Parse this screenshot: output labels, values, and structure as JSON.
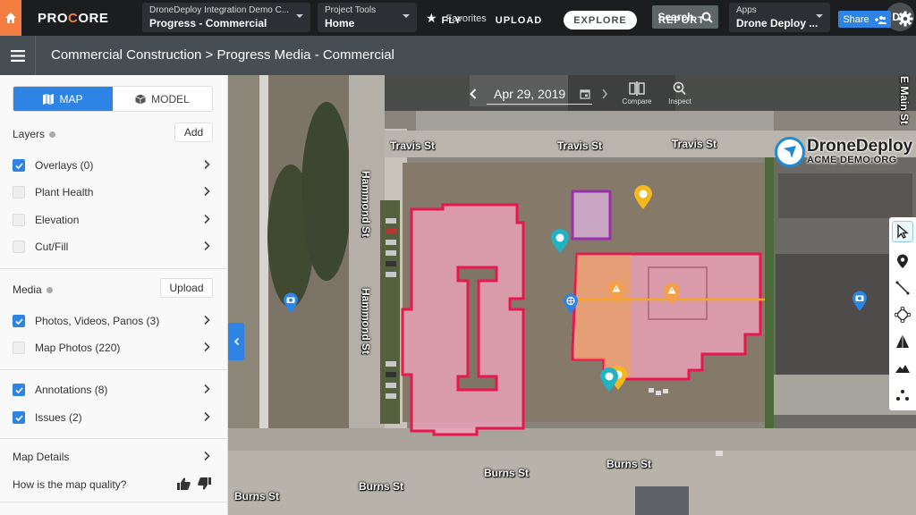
{
  "topbar": {
    "brand": "PROCORE",
    "project_dropdown": {
      "label": "DroneDeploy Integration Demo C...",
      "value": "Progress - Commercial"
    },
    "tools_dropdown": {
      "label": "Project Tools",
      "value": "Home"
    },
    "favorites_label": "Favorites",
    "search_label": "Search",
    "apps_dropdown": {
      "label": "Apps",
      "value": "Drone Deploy ..."
    },
    "avatar_initials": "DA"
  },
  "subheader": {
    "breadcrumb": "Commercial Construction > Progress Media - Commercial",
    "tabs": [
      {
        "label": "FLY",
        "active": false
      },
      {
        "label": "UPLOAD",
        "active": false
      },
      {
        "label": "EXPLORE",
        "active": true
      },
      {
        "label": "REPORT",
        "active": false
      }
    ],
    "share_label": "Share"
  },
  "sidebar": {
    "view_toggle": {
      "map": "MAP",
      "model": "MODEL",
      "selected": "MAP"
    },
    "layers": {
      "title": "Layers",
      "add_label": "Add",
      "items": [
        {
          "label": "Overlays (0)",
          "checked": true
        },
        {
          "label": "Plant Health",
          "checked": false
        },
        {
          "label": "Elevation",
          "checked": false
        },
        {
          "label": "Cut/Fill",
          "checked": false
        }
      ]
    },
    "media": {
      "title": "Media",
      "upload_label": "Upload",
      "items": [
        {
          "label": "Photos, Videos, Panos (3)",
          "checked": true
        },
        {
          "label": "Map Photos (220)",
          "checked": false
        }
      ]
    },
    "annotations": [
      {
        "label": "Annotations (8)",
        "checked": true
      },
      {
        "label": "Issues (2)",
        "checked": true
      }
    ],
    "map_details_label": "Map Details",
    "quality_question": "How is the map quality?"
  },
  "map": {
    "date": "Apr 29, 2019",
    "compare_label": "Compare",
    "inspect_label": "Inspect",
    "streets": {
      "travis_1": "Travis St",
      "travis_2": "Travis St",
      "travis_3": "Travis St",
      "hammond_1": "Hammond St",
      "hammond_2": "Hammond St",
      "main": "E Main St",
      "burns_1": "Burns St",
      "burns_2": "Burns St",
      "burns_3": "Burns St",
      "burns_4": "Burns St"
    },
    "watermark": {
      "title": "DroneDeploy",
      "subtitle": "ACME DEMO.ORG"
    },
    "colors": {
      "area_outline": "#e8174e",
      "area_fill": "#f6a6c0",
      "purple_outline": "#9b2fae",
      "line": "#f5a623",
      "pin_teal": "#1fb3c4",
      "pin_yellow": "#f3b81e",
      "pin_blue": "#2d84e5",
      "issue_orange": "#f5a046"
    },
    "tools": [
      "select",
      "pin",
      "line",
      "area",
      "volume",
      "elevation",
      "more"
    ]
  }
}
